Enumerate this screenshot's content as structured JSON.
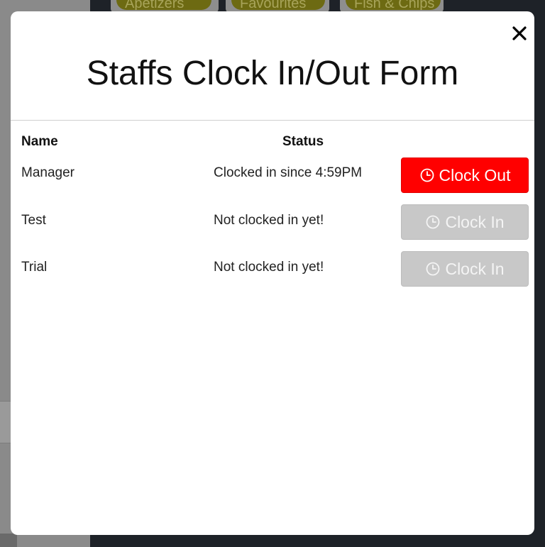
{
  "background": {
    "pills": [
      "Apetizers",
      "Favourites",
      "Fish & Chips"
    ]
  },
  "modal": {
    "title": "Staffs Clock In/Out Form",
    "close_icon": "close-icon",
    "columns": {
      "name": "Name",
      "status": "Status"
    },
    "rows": [
      {
        "name": "Manager",
        "status": "Clocked in since 4:59PM",
        "action": "Clock Out",
        "action_state": "active"
      },
      {
        "name": "Test",
        "status": "Not clocked in yet!",
        "action": "Clock In",
        "action_state": "disabled"
      },
      {
        "name": "Trial",
        "status": "Not clocked in yet!",
        "action": "Clock In",
        "action_state": "disabled"
      }
    ],
    "button_icon": "clock-icon"
  },
  "colors": {
    "clock_out": "#ff0000",
    "clock_in_disabled": "#c8c8c8"
  }
}
